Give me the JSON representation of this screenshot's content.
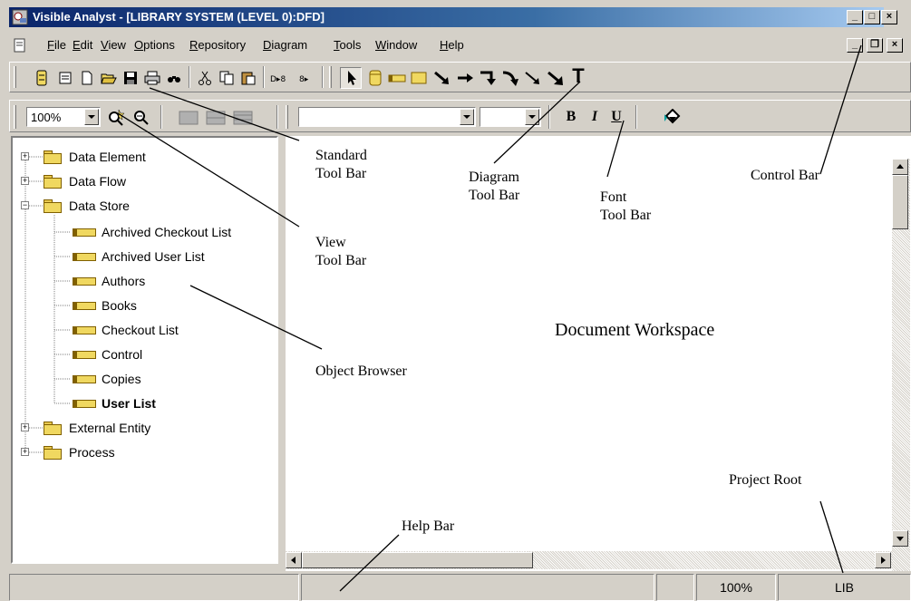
{
  "titlebar": {
    "title": "Visible Analyst - [LIBRARY SYSTEM (LEVEL 0):DFD]"
  },
  "menu": {
    "items": [
      {
        "label": "File",
        "key": "F"
      },
      {
        "label": "Edit",
        "key": "E"
      },
      {
        "label": "View",
        "key": "V"
      },
      {
        "label": "Options",
        "key": "O"
      },
      {
        "label": "Repository",
        "key": "R"
      },
      {
        "label": "Diagram",
        "key": "D"
      },
      {
        "label": "Tools",
        "key": "T"
      },
      {
        "label": "Window",
        "key": "W"
      },
      {
        "label": "Help",
        "key": "H"
      }
    ]
  },
  "view_toolbar": {
    "zoom_value": "100%"
  },
  "font_toolbar": {
    "bold": "B",
    "italic": "I",
    "underline": "U"
  },
  "diagram_toolbar": {
    "text_tool": "T"
  },
  "tree": {
    "items": [
      {
        "label": "Data Element",
        "expander": "+"
      },
      {
        "label": "Data Flow",
        "expander": "+"
      },
      {
        "label": "Data Store",
        "expander": "−"
      },
      {
        "label": "Archived Checkout List"
      },
      {
        "label": "Archived User List"
      },
      {
        "label": "Authors"
      },
      {
        "label": "Books"
      },
      {
        "label": "Checkout List"
      },
      {
        "label": "Control"
      },
      {
        "label": "Copies"
      },
      {
        "label": "User List",
        "bold": true
      },
      {
        "label": "External Entity",
        "expander": "+"
      },
      {
        "label": "Process",
        "expander": "+"
      }
    ]
  },
  "annotations": {
    "standard_toolbar": [
      "Standard",
      "Tool Bar"
    ],
    "diagram_toolbar": [
      "Diagram",
      "Tool Bar"
    ],
    "font_toolbar": [
      "Font",
      "Tool Bar"
    ],
    "control_bar": "Control Bar",
    "view_toolbar": [
      "View",
      "Tool Bar"
    ],
    "object_browser": "Object Browser",
    "document_workspace": "Document Workspace",
    "project_root": "Project Root",
    "help_bar": "Help Bar"
  },
  "statusbar": {
    "zoom": "100%",
    "project": "LIB"
  },
  "colors": {
    "face": "#d4d0c8",
    "title_start": "#0a246a",
    "title_end": "#a6caf0",
    "folder": "#f0d860"
  }
}
